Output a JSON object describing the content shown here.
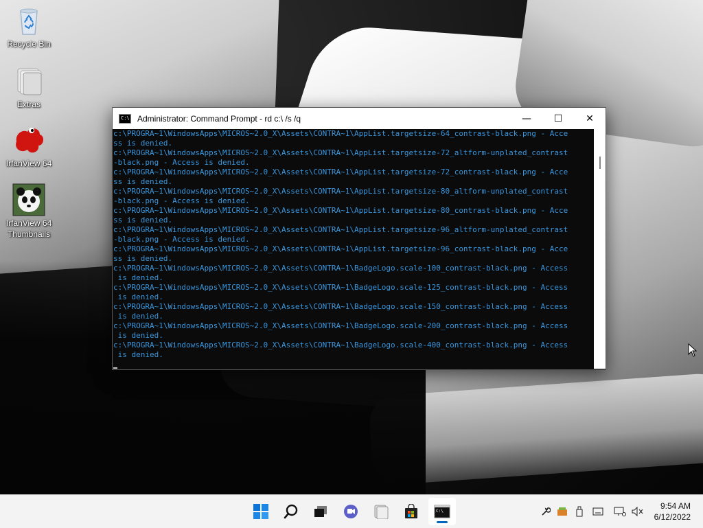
{
  "desktop": {
    "icons": [
      {
        "label": "Recycle Bin",
        "icon": "recycle-bin-icon"
      },
      {
        "label": "Extras",
        "icon": "folder-stack-icon"
      },
      {
        "label": "IrfanView 64",
        "icon": "irfanview-icon"
      },
      {
        "label": "IrfanView 64 Thumbnails",
        "icon": "panda-thumbnails-icon"
      }
    ]
  },
  "window": {
    "title": "Administrator: Command Prompt - rd  c:\\ /s /q",
    "app_icon_text": "C:\\",
    "minimize": "—",
    "maximize": "☐",
    "close": "✕",
    "text_color": "#3a96dd",
    "lines": [
      "c:\\PROGRA~1\\WindowsApps\\MICROS~2.0_X\\Assets\\CONTRA~1\\AppList.targetsize-64_contrast-black.png - Acce",
      "ss is denied.",
      "c:\\PROGRA~1\\WindowsApps\\MICROS~2.0_X\\Assets\\CONTRA~1\\AppList.targetsize-72_altform-unplated_contrast",
      "-black.png - Access is denied.",
      "c:\\PROGRA~1\\WindowsApps\\MICROS~2.0_X\\Assets\\CONTRA~1\\AppList.targetsize-72_contrast-black.png - Acce",
      "ss is denied.",
      "c:\\PROGRA~1\\WindowsApps\\MICROS~2.0_X\\Assets\\CONTRA~1\\AppList.targetsize-80_altform-unplated_contrast",
      "-black.png - Access is denied.",
      "c:\\PROGRA~1\\WindowsApps\\MICROS~2.0_X\\Assets\\CONTRA~1\\AppList.targetsize-80_contrast-black.png - Acce",
      "ss is denied.",
      "c:\\PROGRA~1\\WindowsApps\\MICROS~2.0_X\\Assets\\CONTRA~1\\AppList.targetsize-96_altform-unplated_contrast",
      "-black.png - Access is denied.",
      "c:\\PROGRA~1\\WindowsApps\\MICROS~2.0_X\\Assets\\CONTRA~1\\AppList.targetsize-96_contrast-black.png - Acce",
      "ss is denied.",
      "c:\\PROGRA~1\\WindowsApps\\MICROS~2.0_X\\Assets\\CONTRA~1\\BadgeLogo.scale-100_contrast-black.png - Access",
      " is denied.",
      "c:\\PROGRA~1\\WindowsApps\\MICROS~2.0_X\\Assets\\CONTRA~1\\BadgeLogo.scale-125_contrast-black.png - Access",
      " is denied.",
      "c:\\PROGRA~1\\WindowsApps\\MICROS~2.0_X\\Assets\\CONTRA~1\\BadgeLogo.scale-150_contrast-black.png - Access",
      " is denied.",
      "c:\\PROGRA~1\\WindowsApps\\MICROS~2.0_X\\Assets\\CONTRA~1\\BadgeLogo.scale-200_contrast-black.png - Access",
      " is denied.",
      "c:\\PROGRA~1\\WindowsApps\\MICROS~2.0_X\\Assets\\CONTRA~1\\BadgeLogo.scale-400_contrast-black.png - Access",
      " is denied."
    ]
  },
  "taskbar": {
    "apps": [
      {
        "name": "start-button",
        "icon": "windows-logo-icon"
      },
      {
        "name": "search-button",
        "icon": "search-icon"
      },
      {
        "name": "task-view-button",
        "icon": "task-view-icon"
      },
      {
        "name": "chat-button",
        "icon": "chat-icon"
      },
      {
        "name": "file-explorer-button",
        "icon": "folder-icon"
      },
      {
        "name": "store-button",
        "icon": "store-bag-icon"
      },
      {
        "name": "command-prompt-button",
        "icon": "terminal-icon",
        "active": true
      }
    ],
    "tray_icons": [
      "wrench-icon",
      "package-icon",
      "usb-drive-icon",
      "keyboard-icon",
      "network-icon",
      "volume-muted-icon"
    ],
    "accent_color": "#0067c0",
    "time": "9:54 AM",
    "date": "6/12/2022"
  }
}
